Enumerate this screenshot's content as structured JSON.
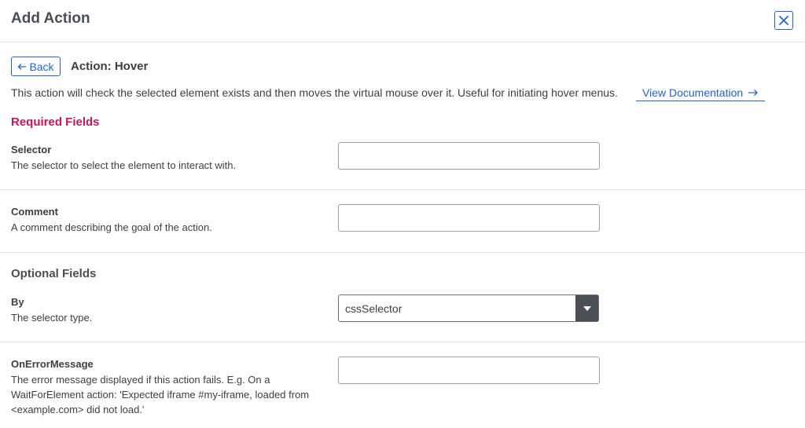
{
  "dialog": {
    "title": "Add Action"
  },
  "action": {
    "back_label": "Back",
    "title": "Action: Hover",
    "description": "This action will check the selected element exists and then moves the virtual mouse over it. Useful for initiating hover menus.",
    "doc_link_label": "View Documentation"
  },
  "required_fields": {
    "heading": "Required Fields",
    "fields": [
      {
        "label": "Selector",
        "description": "The selector to select the element to interact with.",
        "value": "",
        "placeholder": ""
      },
      {
        "label": "Comment",
        "description": "A comment describing the goal of the action.",
        "value": "",
        "placeholder": ""
      }
    ]
  },
  "optional_fields": {
    "heading": "Optional Fields",
    "by": {
      "label": "By",
      "description": "The selector type.",
      "selected": "cssSelector"
    },
    "on_error": {
      "label": "OnErrorMessage",
      "description": "The error message displayed if this action fails. E.g. On a WaitForElement action: 'Expected iframe #my-iframe, loaded from <example.com> did not load.'",
      "value": "",
      "placeholder": ""
    }
  },
  "colors": {
    "accent": "#2563c9",
    "required_heading": "#c2185b",
    "select_arrow_bg": "#4a4f57"
  }
}
